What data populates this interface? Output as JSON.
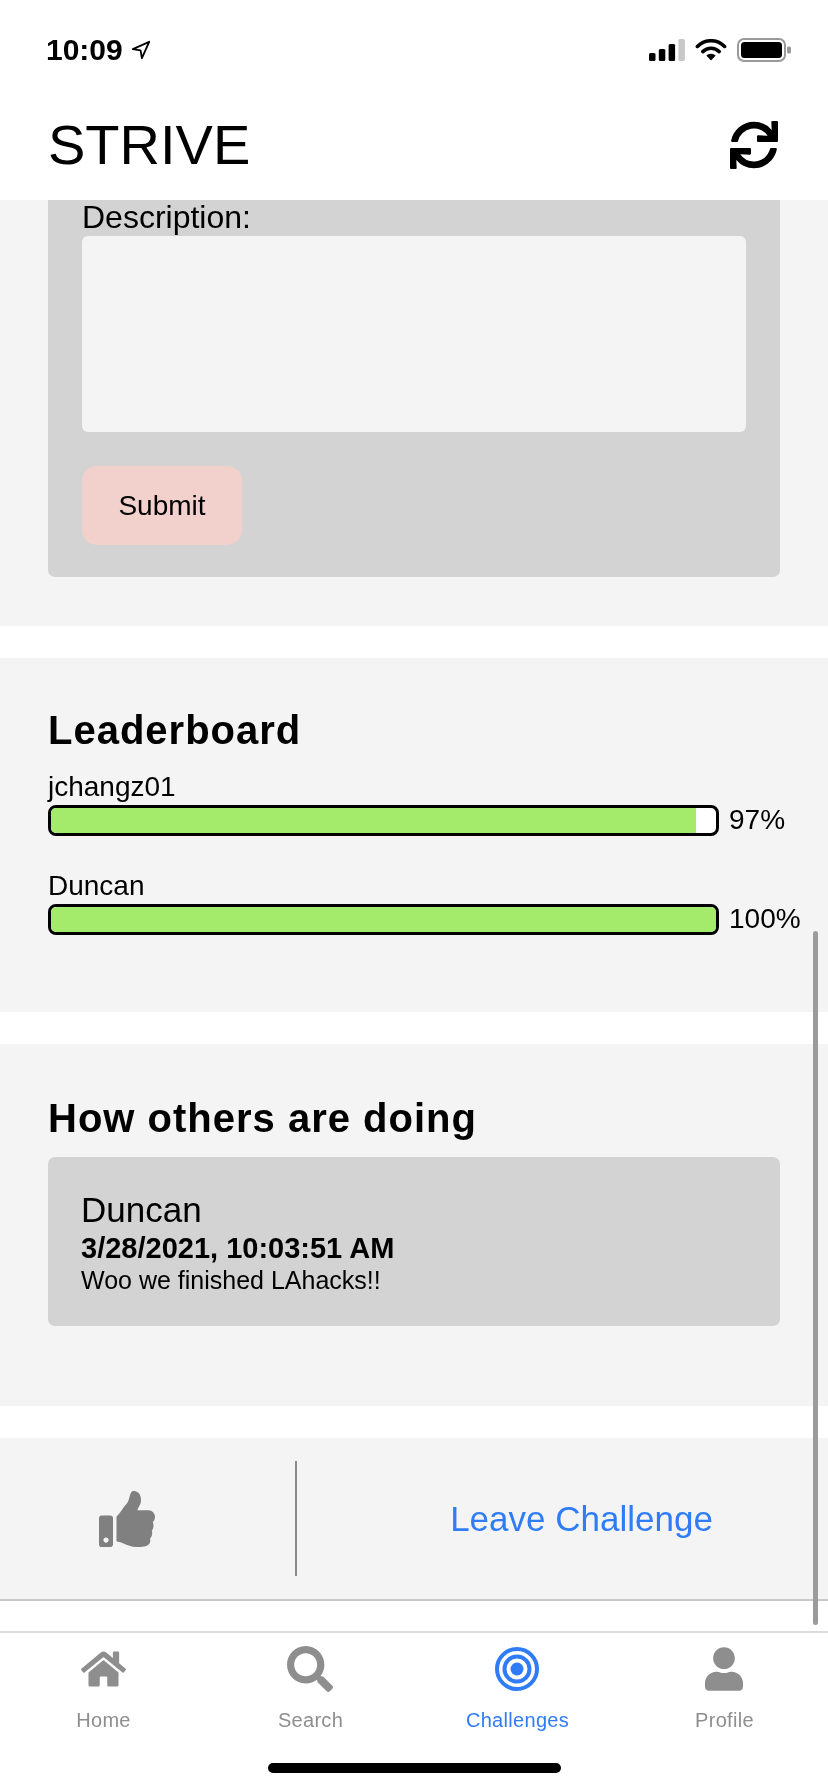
{
  "status_bar": {
    "time": "10:09"
  },
  "header": {
    "title": "STRIVE"
  },
  "post_form": {
    "label": "Description:",
    "submit_button": "Submit"
  },
  "leaderboard": {
    "title": "Leaderboard",
    "entries": [
      {
        "name": "jchangz01",
        "level": 0.97,
        "reading": "97%"
      },
      {
        "name": "Duncan",
        "level": 1,
        "reading": "100%"
      }
    ]
  },
  "updates": {
    "title": "How others are doing",
    "posts": [
      {
        "author": "Duncan",
        "timestamp": "3/28/2021, 10:03:51 AM",
        "message": "Woo we finished LAhacks!!"
      }
    ]
  },
  "actions": {
    "leave_button": "Leave Challenge"
  },
  "tab_bar": {
    "tabs": [
      {
        "label": "Home",
        "selected": false
      },
      {
        "label": "Search",
        "selected": false
      },
      {
        "label": "Challenges",
        "selected": true
      },
      {
        "label": "Profile",
        "selected": false
      }
    ]
  }
}
